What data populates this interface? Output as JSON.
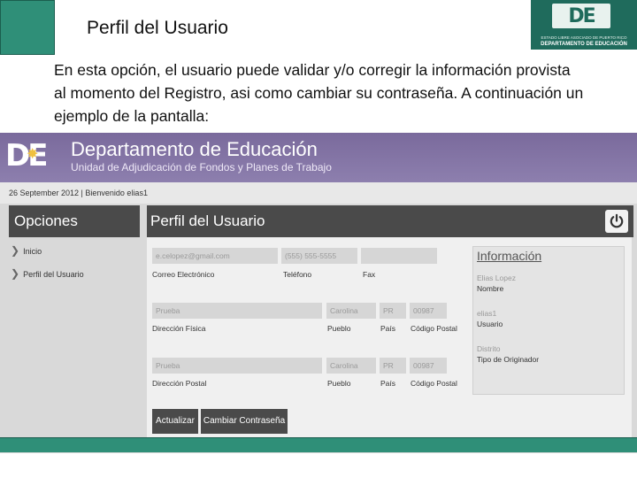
{
  "slide": {
    "title": "Perfil del Usuario",
    "body": "En esta opción, el usuario puede validar y/o corregir la información provista al momento del Registro, asi como cambiar su contraseña.  A continuación un ejemplo de la pantalla:",
    "logo": {
      "mark": "DE",
      "line1": "ESTADO LIBRE ASOCIADO DE PUERTO RICO",
      "line2": "DEPARTAMENTO DE EDUCACIÓN"
    }
  },
  "app": {
    "logo_mark": "DE",
    "brand": "Departamento de Educación",
    "unit": "Unidad de Adjudicación de Fondos y Planes de Trabajo",
    "meta": "26 September 2012 | Bienvenido elias1"
  },
  "sidebar": {
    "title": "Opciones",
    "items": [
      {
        "label": "Inicio"
      },
      {
        "label": "Perfil del Usuario"
      }
    ]
  },
  "profile": {
    "title": "Perfil del Usuario",
    "email": {
      "value": "e.celopez@gmail.com",
      "label": "Correo Electrónico"
    },
    "phone": {
      "value": "(555) 555-5555",
      "label": "Teléfono"
    },
    "fax": {
      "value": "",
      "label": "Fax"
    },
    "physical": {
      "address": {
        "value": "Prueba",
        "label": "Dirección Física"
      },
      "town": {
        "value": "Carolina",
        "label": "Pueblo"
      },
      "country": {
        "value": "PR",
        "label": "País"
      },
      "zip": {
        "value": "00987",
        "label": "Código Postal"
      }
    },
    "postal": {
      "address": {
        "value": "Prueba",
        "label": "Dirección Postal"
      },
      "town": {
        "value": "Carolina",
        "label": "Pueblo"
      },
      "country": {
        "value": "PR",
        "label": "País"
      },
      "zip": {
        "value": "00987",
        "label": "Código Postal"
      }
    },
    "buttons": {
      "update": "Actualizar",
      "change_password": "Cambiar Contraseña"
    }
  },
  "info": {
    "title": "Información",
    "name_value": "Elias Lopez",
    "name_label": "Nombre",
    "user_value": "elias1",
    "user_label": "Usuario",
    "origin_value": "Distrito",
    "origin_label": "Tipo de Originador"
  },
  "colors": {
    "green": "#2f8f78",
    "purple": "#7a6a9c",
    "dark": "#4a4a4a"
  }
}
